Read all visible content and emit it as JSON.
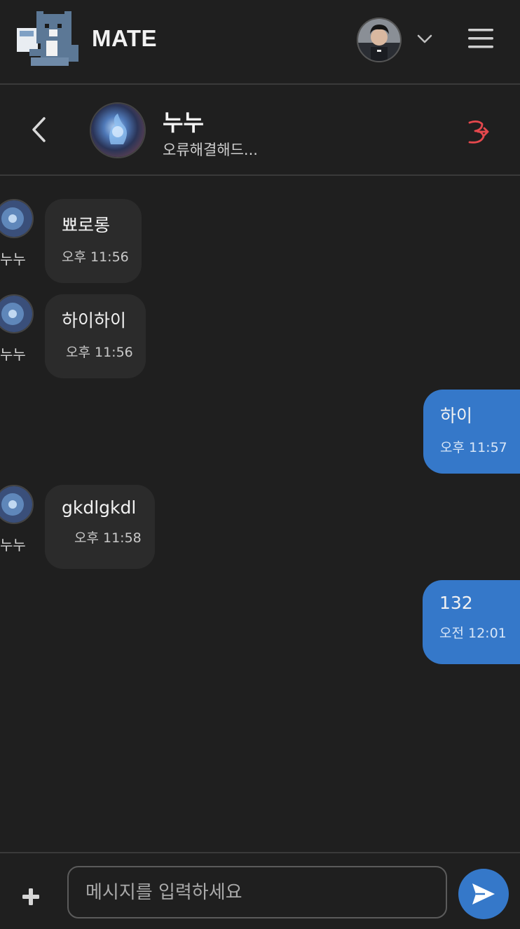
{
  "app": {
    "brand": "MATE"
  },
  "header": {
    "logo_icon": "pixel-cat-logo",
    "user_avatar_icon": "user-avatar",
    "dropdown_icon": "chevron-down-icon",
    "menu_icon": "hamburger-menu-icon"
  },
  "chat_header": {
    "back_icon": "chevron-left-icon",
    "partner_name": "누누",
    "partner_status": "오류해결해드...",
    "leave_icon": "exit-chat-icon",
    "leave_color": "#e5484d"
  },
  "messages": [
    {
      "direction": "in",
      "sender": "누누",
      "text": "뾰로롱",
      "time": "오후 11:56"
    },
    {
      "direction": "in",
      "sender": "누누",
      "text": "하이하이",
      "time": "오후 11:56"
    },
    {
      "direction": "out",
      "text": "하이",
      "time": "오후 11:57"
    },
    {
      "direction": "in",
      "sender": "누누",
      "text": "gkdlgkdl",
      "time": "오후 11:58"
    },
    {
      "direction": "out",
      "text": "132",
      "time": "오전 12:01"
    }
  ],
  "composer": {
    "attach_icon": "plus-icon",
    "placeholder": "메시지를 입력하세요",
    "value": "",
    "send_icon": "send-icon"
  },
  "colors": {
    "background": "#1f1f1f",
    "incoming_bubble": "#2b2b2b",
    "outgoing_bubble": "#3578c9",
    "accent": "#3578c9"
  }
}
